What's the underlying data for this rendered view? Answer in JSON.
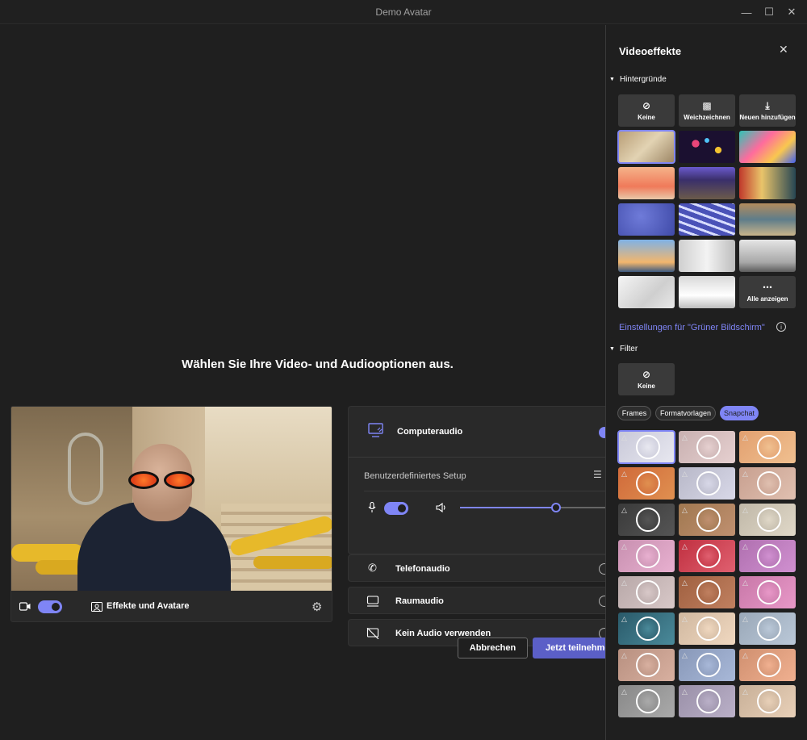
{
  "window": {
    "title": "Demo Avatar"
  },
  "main": {
    "heading": "Wählen Sie Ihre Video- und Audiooptionen aus.",
    "preview": {
      "effects_label": "Effekte und Avatare"
    },
    "audio": {
      "computer_audio": "Computeraudio",
      "custom_setup": "Benutzerdefiniertes Setup",
      "phone_audio": "Telefonaudio",
      "room_audio": "Raumaudio",
      "no_audio": "Kein Audio verwenden",
      "volume": 0.62
    },
    "cancel_label": "Abbrechen",
    "join_label": "Jetzt teilnehmen"
  },
  "panel": {
    "title": "Videoeffekte",
    "backgrounds_section": "Hintergründe",
    "bg_options": [
      "Keine",
      "Weichzeichnen",
      "Neuen hinzufügen"
    ],
    "show_all": "Alle anzeigen",
    "green_screen": "Einstellungen für \"Grüner Bildschirm\"",
    "filter_section": "Filter",
    "filter_none": "Keine",
    "chips": [
      "Frames",
      "Formatvorlagen",
      "Snapchat"
    ]
  },
  "colors": {
    "accent": "#7f85f5",
    "bg": "#1f1f1f",
    "card": "#292929"
  }
}
